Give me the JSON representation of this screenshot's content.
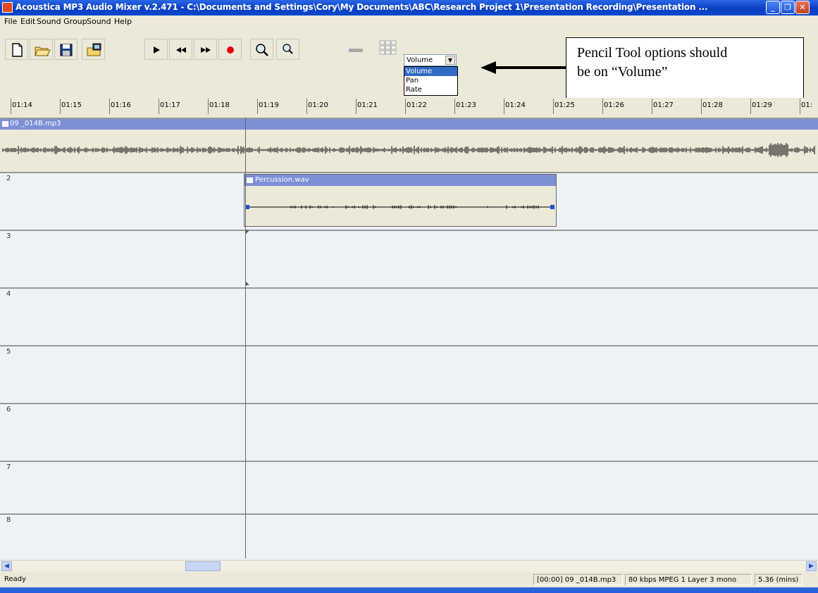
{
  "window": {
    "title": "Acoustica MP3 Audio Mixer v.2.471 - C:\\Documents and Settings\\Cory\\My Documents\\ABC\\Research Project 1\\Presentation Recording\\Presentation ...",
    "minimize_label": "_",
    "restore_label": "❐",
    "close_label": "✕"
  },
  "menu": [
    "File",
    "Edit",
    "Sound Group",
    "Sound",
    "Help"
  ],
  "toolbar": {
    "icons": [
      "new-file-icon",
      "open-folder-icon",
      "save-disk-icon",
      "import-icon",
      "play-icon",
      "rewind-icon",
      "fast-forward-icon",
      "record-icon",
      "zoom-in-icon",
      "zoom-out-icon",
      "pencil-tool-icon",
      "grid-tool-icon"
    ],
    "pencil_option_selected": "Volume",
    "pencil_options": [
      "Volume",
      "Pan",
      "Rate"
    ]
  },
  "callout": {
    "line1": "Pencil Tool options should",
    "line2": "be on “Volume”"
  },
  "ruler": {
    "ticks": [
      "01:14",
      "01:15",
      "01:16",
      "01:17",
      "01:18",
      "01:19",
      "01:20",
      "01:21",
      "01:22",
      "01:23",
      "01:24",
      "01:25",
      "01:26",
      "01:27",
      "01:28",
      "01:29",
      "01:"
    ]
  },
  "tracks": [
    {
      "number": "",
      "clip": "09 _014B.mp3"
    },
    {
      "number": "2",
      "clip": "Percussion.wav"
    },
    {
      "number": "3"
    },
    {
      "number": "4"
    },
    {
      "number": "5"
    },
    {
      "number": "6"
    },
    {
      "number": "7"
    },
    {
      "number": "8"
    }
  ],
  "status": {
    "left": "Ready",
    "position_file": "[00:00] 09 _014B.mp3",
    "format": "80 kbps MPEG 1 Layer 3 mono",
    "length": "5.36 (mins)"
  },
  "colors": {
    "titlebar": "#0a3fc0",
    "clip_header": "#7d8fd6",
    "track_bg": "#eef2f7",
    "chrome": "#ece9d8"
  }
}
